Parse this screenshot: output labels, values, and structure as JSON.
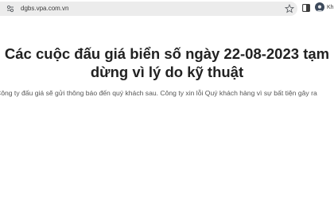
{
  "browser": {
    "url": "dgbs.vpa.com.vn",
    "profile_label": "Kh"
  },
  "main": {
    "title": "Các cuộc đấu giá biển số ngày 22-08-2023 tạm dừng vì lý do kỹ thuật",
    "message": "Công ty đấu giá sẽ gửi thông báo đến quý khách sau. Công ty xin lỗi Quý khách hàng vì sự bất tiện gây ra"
  },
  "icons": {
    "lock": "site-info-icon",
    "star": "bookmark-star-icon",
    "sidepanel": "side-panel-icon",
    "avatar": "profile-avatar-icon"
  }
}
